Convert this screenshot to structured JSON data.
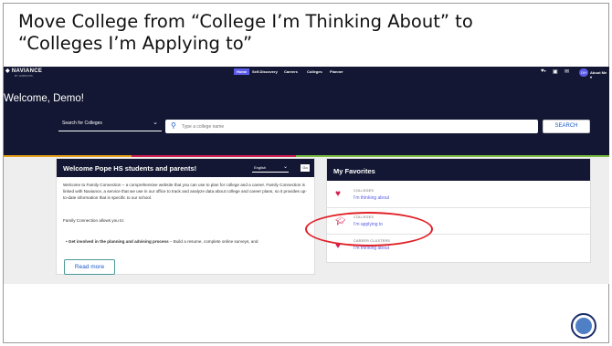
{
  "slide": {
    "title_line1": "Move College from “College I’m Thinking About” to",
    "title_line2": "“Colleges I’m Applying to”"
  },
  "navbar": {
    "logo": "NAVIANCE",
    "logo_sub": "BY HOBSONS",
    "items": [
      "Home",
      "Self-Discovery",
      "Careers",
      "Colleges",
      "Planner"
    ],
    "active_item": "Home",
    "avatar_initials": "DH",
    "about_me": "About Me ▾"
  },
  "hero": {
    "welcome": "Welcome, Demo!",
    "search_scope": "Search for Colleges",
    "search_placeholder": "Type a college name",
    "search_button": "SEARCH"
  },
  "welcome_card": {
    "title": "Welcome Pope HS students and parents!",
    "language": "English",
    "go_label": "Go",
    "paragraph1": "Welcome to Family Connection – a comprehensive website that you can use to plan for college and a career. Family Connection is linked with Naviance, a service that we use in our office to track and analyze data about college and career plans, so it provides up-to-date information that is specific to our school.",
    "paragraph2": "Family Connection allows you to:",
    "bullet_bold": "Get involved in the planning and advising process",
    "bullet_rest": " – Build a resume, complete online surveys, and",
    "read_more": "Read more"
  },
  "favorites_card": {
    "title": "My Favorites",
    "items": [
      {
        "category": "COLLEGES",
        "status": "I'm thinking about",
        "icon": "heart-icon"
      },
      {
        "category": "COLLEGES",
        "status": "I'm applying to",
        "icon": "graduation-cap-icon"
      },
      {
        "category": "CAREER CLUSTERS",
        "status": "I'm thinking about",
        "icon": "heart-icon"
      }
    ]
  },
  "colors": {
    "navy": "#141733",
    "accent": "#5a5ce8",
    "heart": "#d21f52",
    "highlight_oval": "#e11f26"
  }
}
